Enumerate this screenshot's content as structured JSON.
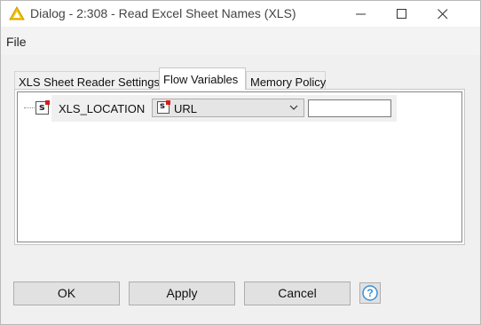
{
  "window": {
    "title": "Dialog - 2:308 - Read Excel Sheet Names (XLS)"
  },
  "menu": {
    "file_label": "File"
  },
  "tabs": [
    {
      "label": "XLS Sheet Reader Settings",
      "selected": false
    },
    {
      "label": "Flow Variables",
      "selected": true
    },
    {
      "label": "Memory Policy",
      "selected": false
    }
  ],
  "flow_variables": {
    "row": {
      "name": "XLS_LOCATION",
      "type_icon": "string-variable-icon",
      "selected_option": "URL",
      "value": ""
    }
  },
  "buttons": {
    "ok_label": "OK",
    "apply_label": "Apply",
    "cancel_label": "Cancel",
    "help_icon": "help-icon"
  },
  "colors": {
    "accent_blue": "#3c8fd6",
    "variable_marker_red": "#d81c1c",
    "app_icon_yellow": "#f2c200"
  }
}
